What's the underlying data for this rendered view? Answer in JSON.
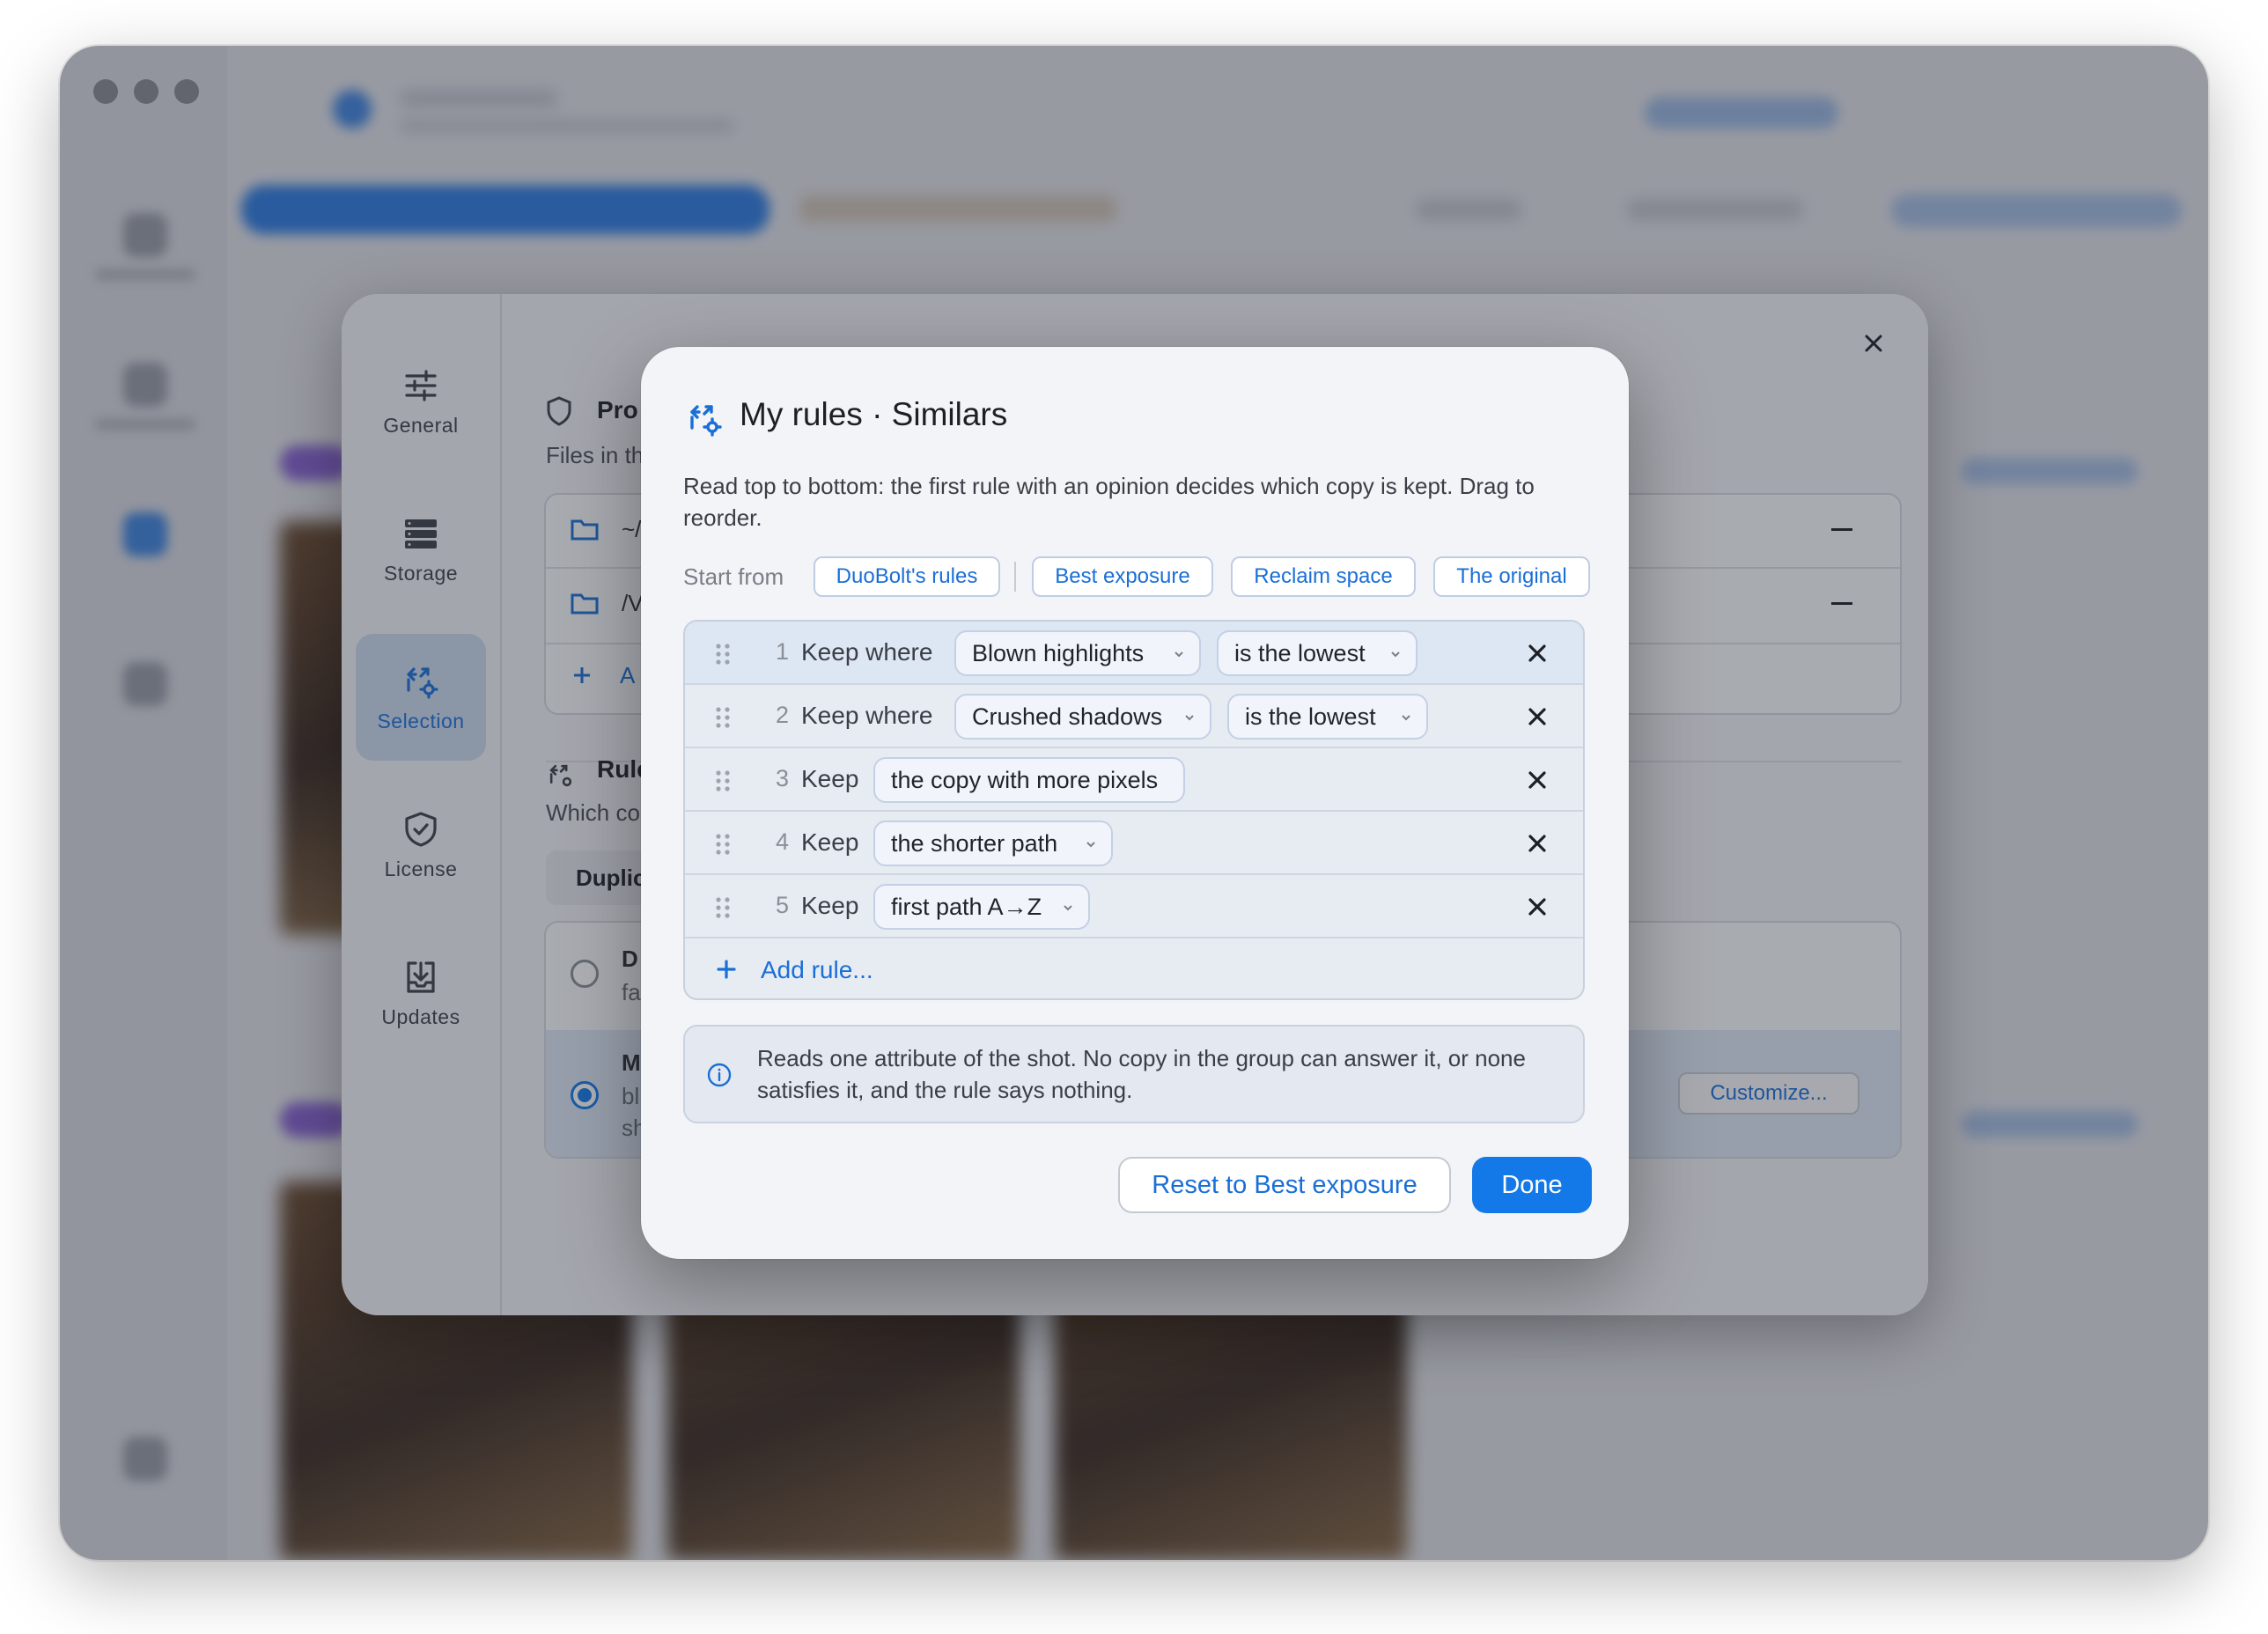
{
  "prefs": {
    "nav": [
      {
        "label": "General",
        "icon": "sliders-icon"
      },
      {
        "label": "Storage",
        "icon": "storage-icon"
      },
      {
        "label": "Selection",
        "icon": "selection-icon"
      },
      {
        "label": "License",
        "icon": "shield-check-icon"
      },
      {
        "label": "Updates",
        "icon": "download-tray-icon"
      }
    ],
    "section1_title": "Pro",
    "section1_sub": "Files in th",
    "folder_rows": [
      "~/",
      "/V"
    ],
    "add_label": "A",
    "section2_title": "Rule",
    "section2_sub": "Which co",
    "tab_label": "Duplic",
    "option1_title": "D",
    "option1_sub": "fa",
    "option2_title": "M",
    "option2_sub1": "bl",
    "option2_sub2": "sh",
    "customize_label": "Customize..."
  },
  "modal": {
    "title": "My rules · Similars",
    "description": "Read top to bottom: the first rule with an opinion decides which copy is kept. Drag to reorder.",
    "start_from_label": "Start from",
    "presets": [
      "DuoBolt's rules",
      "Best exposure",
      "Reclaim space",
      "The original"
    ],
    "rules": [
      {
        "num": "1",
        "keep": "Keep where",
        "chip1": "Blown highlights",
        "chip2": "is the lowest"
      },
      {
        "num": "2",
        "keep": "Keep where",
        "chip1": "Crushed shadows",
        "chip2": "is the lowest"
      },
      {
        "num": "3",
        "keep": "Keep",
        "chip1": "the copy with more pixels"
      },
      {
        "num": "4",
        "keep": "Keep",
        "chip1": "the shorter path"
      },
      {
        "num": "5",
        "keep": "Keep",
        "chip1": "first path A→Z"
      }
    ],
    "add_rule_label": "Add rule...",
    "info_text": "Reads one attribute of the shot. No copy in the group can answer it, or none satisfies it, and the rule says nothing.",
    "reset_label": "Reset to Best exposure",
    "done_label": "Done"
  },
  "colors": {
    "accent": "#1479e8",
    "link": "#1a6fd6"
  }
}
